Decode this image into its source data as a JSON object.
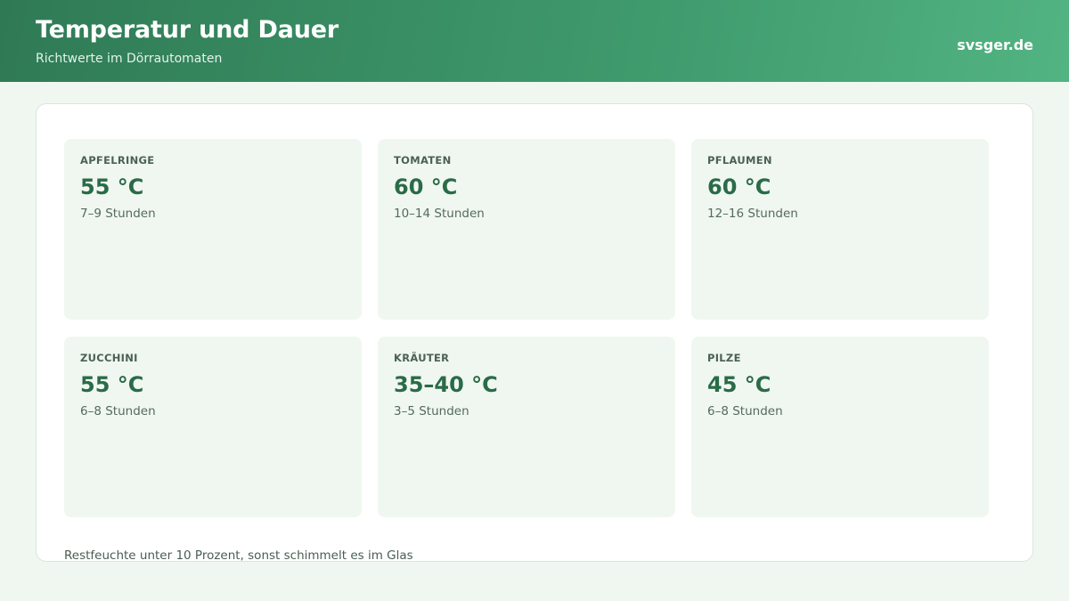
{
  "header": {
    "title": "Temperatur und Dauer",
    "subtitle": "Richtwerte im Dörrautomaten",
    "brand": "svsger.de"
  },
  "cards": [
    {
      "name": "APFELRINGE",
      "temp": "55 °C",
      "duration": "7–9 Stunden"
    },
    {
      "name": "TOMATEN",
      "temp": "60 °C",
      "duration": "10–14 Stunden"
    },
    {
      "name": "PFLAUMEN",
      "temp": "60 °C",
      "duration": "12–16 Stunden"
    },
    {
      "name": "ZUCCHINI",
      "temp": "55 °C",
      "duration": "6–8 Stunden"
    },
    {
      "name": "KRÄUTER",
      "temp": "35–40 °C",
      "duration": "3–5 Stunden"
    },
    {
      "name": "PILZE",
      "temp": "45 °C",
      "duration": "6–8 Stunden"
    }
  ],
  "footnote": "Restfeuchte unter 10 Prozent, sonst schimmelt es im Glas",
  "colors": {
    "header_start": "#2f7a55",
    "header_end": "#52b482",
    "accent_temp": "#2a6b48",
    "card_bg": "#f0f7f0"
  }
}
